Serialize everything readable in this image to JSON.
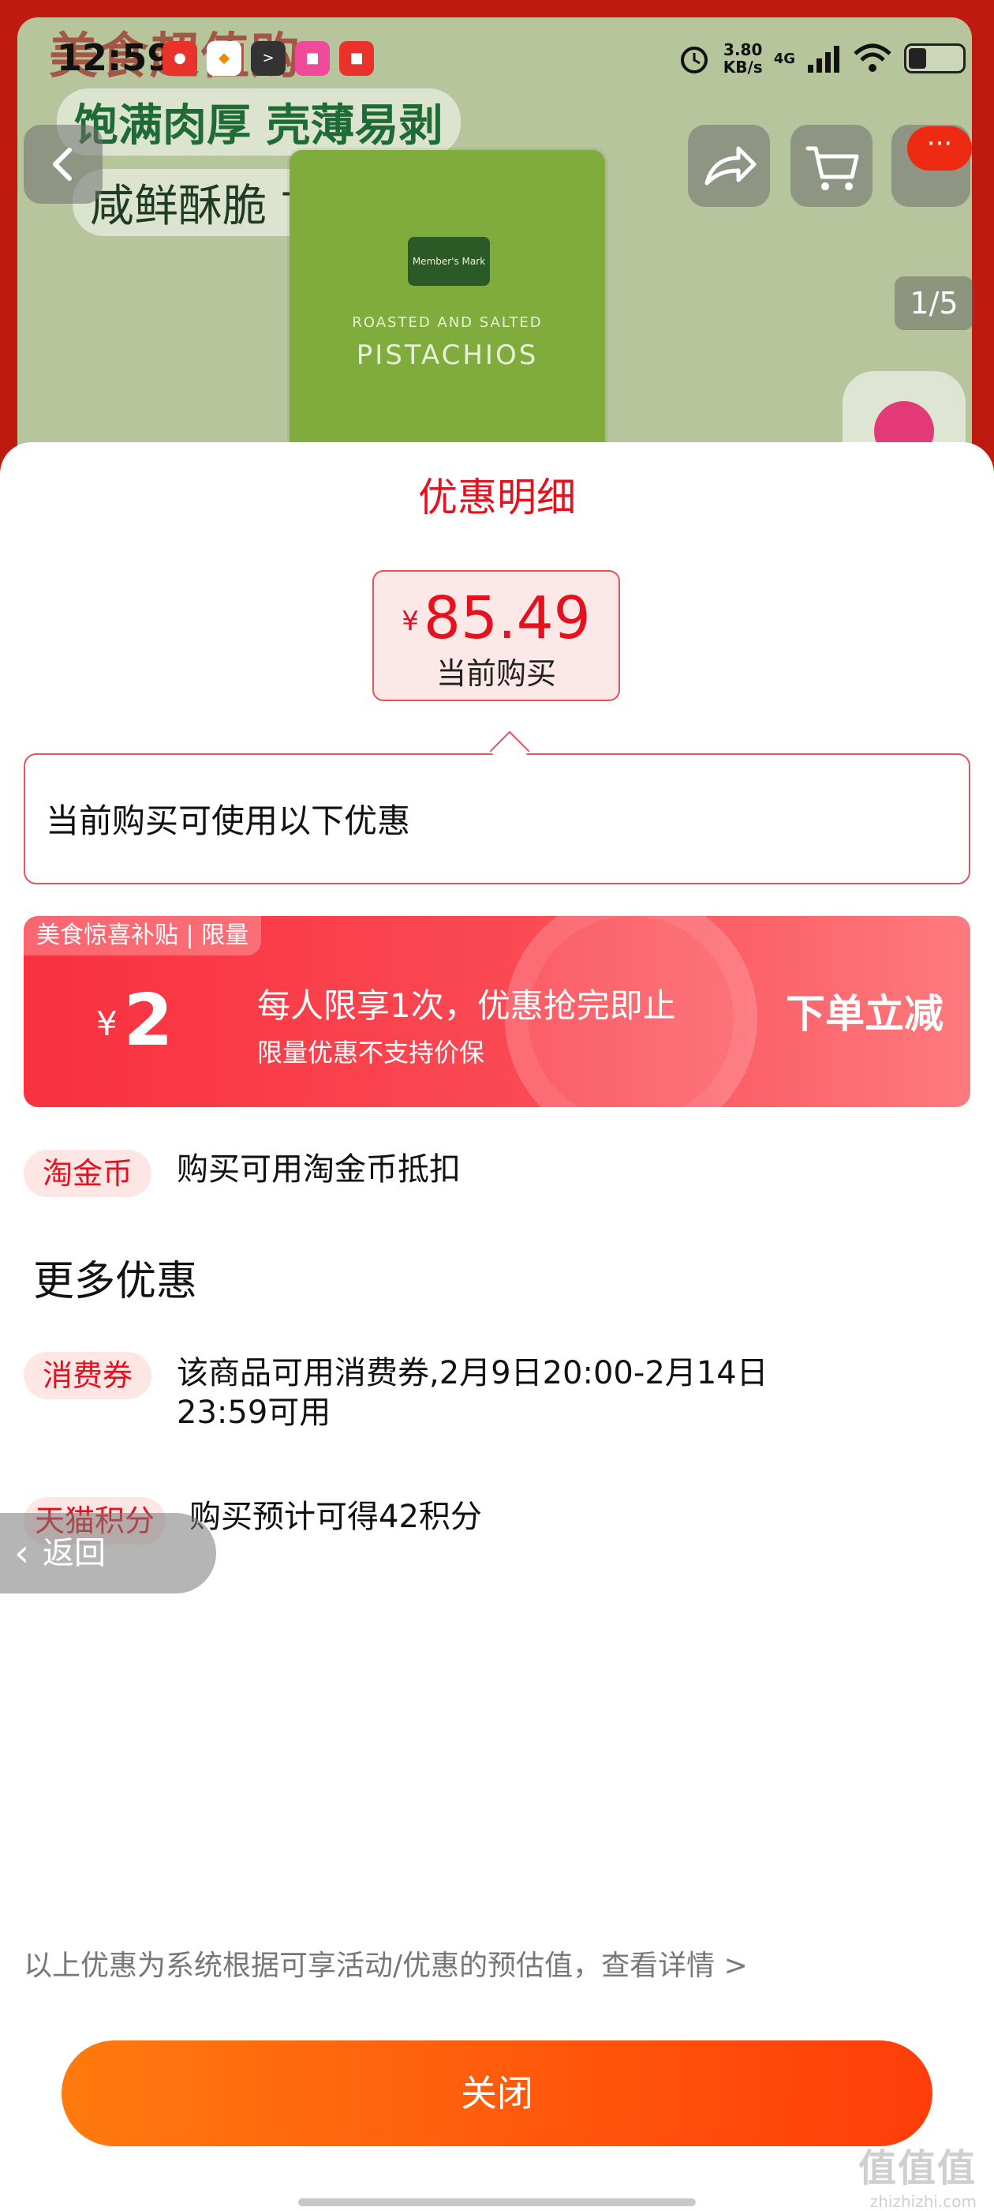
{
  "colors": {
    "accent_red": "#e5111e",
    "subsidy_red": "#f8313e",
    "button_orange": "#ff5a0c"
  },
  "status_bar": {
    "time": "12:59",
    "net_speed": "3.80",
    "net_unit": "KB/s",
    "network": "4G",
    "app_icons": [
      "taobao-pay-icon",
      "app-icon",
      "terminal-icon",
      "shop-icon",
      "shop-icon"
    ]
  },
  "background": {
    "banner_title": "美食超值购",
    "slogan_1": "饱满肉厚 壳薄易剥",
    "slogan_2": "咸鲜酥脆 甘香回味",
    "product_brand": "Member's Mark",
    "product_line1": "ROASTED AND SALTED",
    "product_line2": "PISTACHIOS",
    "pager": "1/5",
    "more": "···"
  },
  "sheet": {
    "title": "优惠明细",
    "price_symbol": "¥",
    "price": "85.49",
    "price_label": "当前购买",
    "callout_text": "当前购买可使用以下优惠",
    "subsidy": {
      "tag": "美食惊喜补贴 | 限量",
      "symbol": "¥",
      "amount": "2",
      "main": "每人限享1次，优惠抢完即止",
      "sub": "限量优惠不支持价保",
      "action": "下单立减"
    },
    "coin": {
      "tag": "淘金币",
      "text": "购买可用淘金币抵扣"
    },
    "more_title": "更多优惠",
    "voucher": {
      "tag": "消费券",
      "line1": "该商品可用消费券,2月9日20:00-2月14日",
      "line2": "23:59可用"
    },
    "points": {
      "tag": "天猫积分",
      "text": "购买预计可得42积分"
    },
    "fine_print": "以上优惠为系统根据可享活动/优惠的预估值，查看详情 >",
    "close": "关闭"
  },
  "float_back": {
    "chevron": "‹",
    "label": "返回"
  },
  "watermark": {
    "big": "值值值",
    "small": "zhizhizhi.com"
  }
}
